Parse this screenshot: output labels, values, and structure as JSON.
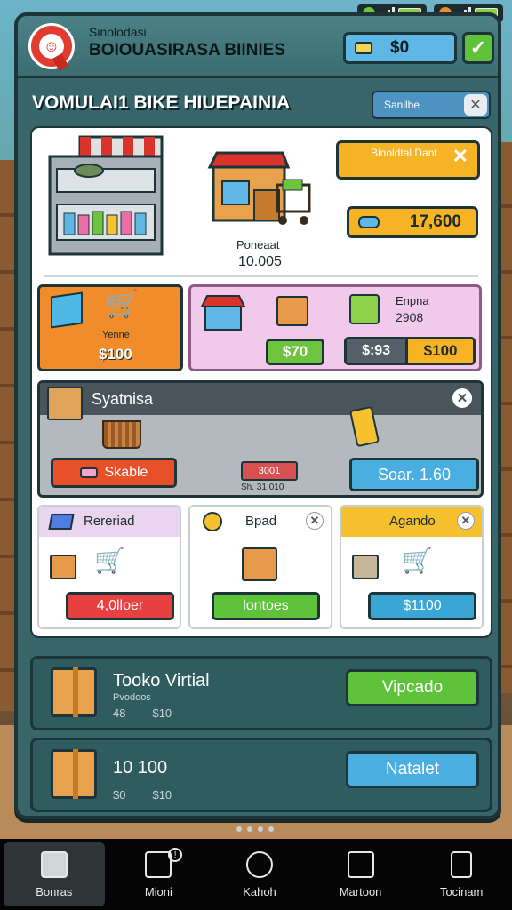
{
  "status": {
    "battery_color": "#8ad04a"
  },
  "header": {
    "app_subtitle": "Sinolodasi",
    "app_title": "BOIOUASIRASA BIINIES",
    "coins": "$0",
    "confirm_icon": "check-icon"
  },
  "subtitle": "VOMULAI1 BIKE HIUEPAINIA",
  "search": {
    "placeholder": "Sanilbe"
  },
  "showcase": {
    "store_label": "Poneaat",
    "store_value": "10.005",
    "promo_text": "Binoldtal Dant",
    "price": "17,600"
  },
  "row2": {
    "orange": {
      "label": "Yenne",
      "price": "$100"
    },
    "pink": {
      "title": "Enpna",
      "value": "2908",
      "green_price": "$70",
      "price_a": "$:93",
      "price_b": "$100"
    }
  },
  "grey_card": {
    "title": "Syatnisa",
    "red_button": "Skable",
    "tag": "3001",
    "tag_sub": "Sh. 31 010",
    "blue_button": "Soar. 1.60"
  },
  "mini_cards": [
    {
      "title": "Rereriad",
      "button": "4,0lloer",
      "head_color": "#e9d5f0",
      "button_color": "#e84040"
    },
    {
      "title": "Bpad",
      "button": "lontoes",
      "head_color": "#ffffff",
      "button_color": "#5ec33a"
    },
    {
      "title": "Agando",
      "button": "$1100",
      "head_color": "#f6c12e",
      "button_color": "#3aa6d6"
    }
  ],
  "wide_rows": [
    {
      "title": "Tooko Virtial",
      "sub": "Pvodoos",
      "num_a": "48",
      "num_b": "$10",
      "button": "Vipcado",
      "button_color": "#5ec33a"
    },
    {
      "title": "10 100",
      "sub": "",
      "num_a": "$0",
      "num_b": "$10",
      "button": "Natalet",
      "button_color": "#4aaee0"
    }
  ],
  "nav": [
    {
      "label": "Bonras",
      "icon": "house-icon"
    },
    {
      "label": "Mioni",
      "icon": "tag-icon"
    },
    {
      "label": "Kahoh",
      "icon": "search-icon"
    },
    {
      "label": "Martoon",
      "icon": "square-icon"
    },
    {
      "label": "Tocinam",
      "icon": "phone-icon"
    }
  ],
  "nav_badge": "!"
}
